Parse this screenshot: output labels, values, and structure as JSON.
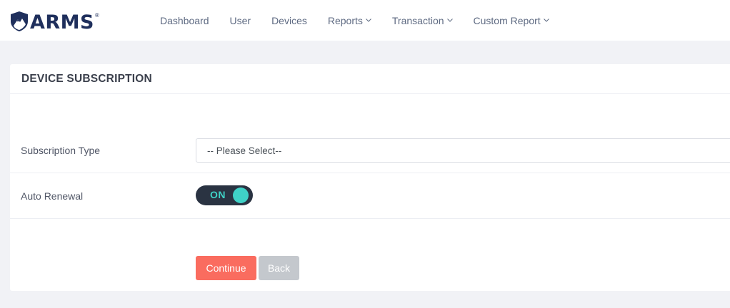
{
  "brand": {
    "name": "ARMS",
    "registered_mark": "®",
    "logo_icon": "shield-mountain-icon",
    "color": "#1f2f5c"
  },
  "nav": {
    "items": [
      {
        "label": "Dashboard",
        "has_dropdown": false
      },
      {
        "label": "User",
        "has_dropdown": false
      },
      {
        "label": "Devices",
        "has_dropdown": false
      },
      {
        "label": "Reports",
        "has_dropdown": true
      },
      {
        "label": "Transaction",
        "has_dropdown": true
      },
      {
        "label": "Custom Report",
        "has_dropdown": true
      }
    ],
    "dropdown_icon": "chevron-down-icon"
  },
  "card": {
    "title": "DEVICE SUBSCRIPTION"
  },
  "form": {
    "subscription_type": {
      "label": "Subscription Type",
      "selected": "-- Please Select--"
    },
    "auto_renewal": {
      "label": "Auto Renewal",
      "state_label": "ON",
      "enabled": true,
      "accent": "#3fd2c7"
    },
    "buttons": {
      "continue_label": "Continue",
      "continue_color": "#fa6c5f",
      "back_label": "Back",
      "back_color": "#c4c8cd"
    }
  }
}
